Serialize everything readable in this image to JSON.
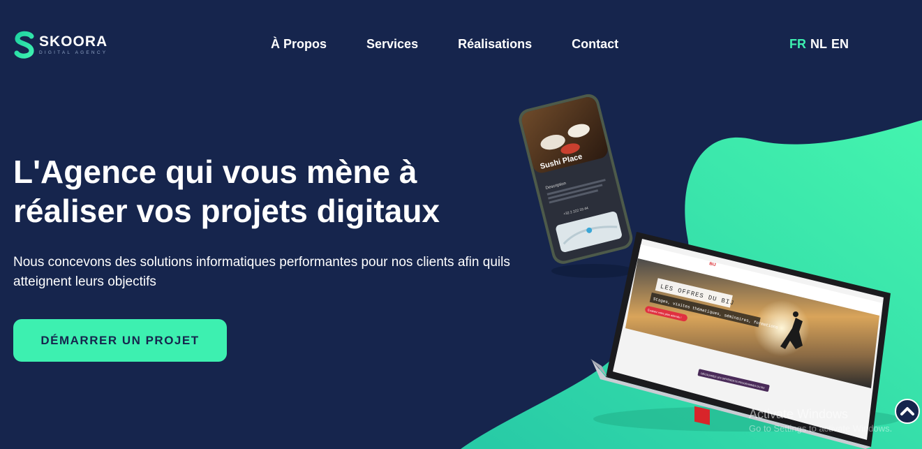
{
  "brand": {
    "name": "SKOORA",
    "tagline": "DIGITAL AGENCY",
    "accent_color": "#3df0b0",
    "background_color": "#16254d"
  },
  "nav": {
    "items": [
      "À Propos",
      "Services",
      "Réalisations",
      "Contact"
    ]
  },
  "languages": {
    "items": [
      "FR",
      "NL",
      "EN"
    ],
    "active": "FR"
  },
  "hero": {
    "title": "L'Agence qui vous mène à réaliser vos projets digitaux",
    "subtitle": "Nous concevons des solutions informatiques performantes pour nos clients afin quils atteignent leurs objectifs",
    "cta_label": "DÉMARRER UN PROJET"
  },
  "phone_mockup": {
    "title": "Sushi Place",
    "section_label": "Description",
    "phone_number": "+32 2 222 33 44"
  },
  "laptop_mockup": {
    "banner_line1": "LES OFFRES DU BIJ",
    "banner_line2": "Stages, visites thématiques, séminaires, formations",
    "button_label": "Évaluez votre plan attendu !",
    "footer_button": "DÉCOUVREZ LES DIFFÉRENTS PROGRAMMES DU BIJ",
    "logo_text": "BIJ"
  },
  "watermark": {
    "title": "Activate Windows",
    "subtitle": "Go to Settings to activate Windows."
  },
  "icons": {
    "scroll_top": "chevron-up-icon"
  }
}
